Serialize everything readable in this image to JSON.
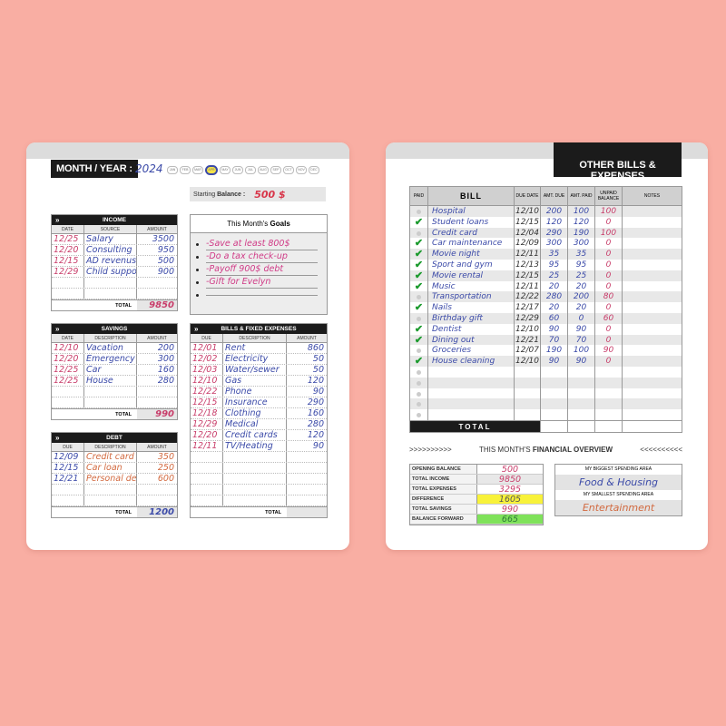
{
  "left": {
    "month_year_label": "MONTH / YEAR :",
    "year": "2024",
    "months": [
      "JAN",
      "FEB",
      "MAR",
      "APR",
      "MAY",
      "JUN",
      "JUL",
      "AUG",
      "SEP",
      "OCT",
      "NOV",
      "DEC"
    ],
    "selected_month": "APR",
    "starting_balance_label": "Starting",
    "starting_balance_label_bold": "Balance :",
    "starting_balance": "500 $",
    "income": {
      "title": "INCOME",
      "columns": [
        "DATE",
        "SOURCE",
        "AMOUNT"
      ],
      "rows": [
        {
          "date": "12/25",
          "desc": "Salary",
          "amount": "3500"
        },
        {
          "date": "12/20",
          "desc": "Consulting",
          "amount": "950"
        },
        {
          "date": "12/15",
          "desc": "AD revenus",
          "amount": "500"
        },
        {
          "date": "12/29",
          "desc": "Child support",
          "amount": "900"
        },
        {
          "date": "",
          "desc": "",
          "amount": ""
        },
        {
          "date": "",
          "desc": "",
          "amount": ""
        }
      ],
      "total_label": "TOTAL",
      "total": "9850"
    },
    "goals": {
      "title": "This Month's",
      "title_bold": "Goals",
      "items": [
        "-Save at least 800$",
        "-Do a tax check-up",
        "-Payoff 900$ debt",
        "-Gift for Evelyn",
        ""
      ]
    },
    "savings": {
      "title": "SAVINGS",
      "columns": [
        "DATE",
        "DESCRIPTION",
        "AMOUNT"
      ],
      "rows": [
        {
          "date": "12/10",
          "desc": "Vacation",
          "amount": "200"
        },
        {
          "date": "12/20",
          "desc": "Emergency",
          "amount": "300"
        },
        {
          "date": "12/25",
          "desc": "Car",
          "amount": "160"
        },
        {
          "date": "12/25",
          "desc": "House",
          "amount": "280"
        },
        {
          "date": "",
          "desc": "",
          "amount": ""
        },
        {
          "date": "",
          "desc": "",
          "amount": ""
        }
      ],
      "total_label": "TOTAL",
      "total": "990"
    },
    "bills": {
      "title": "BILLS & FIXED EXPENSES",
      "columns": [
        "DUE",
        "DESCRIPTION",
        "AMOUNT"
      ],
      "rows": [
        {
          "date": "12/01",
          "desc": "Rent",
          "amount": "860"
        },
        {
          "date": "12/02",
          "desc": "Electricity",
          "amount": "50"
        },
        {
          "date": "12/03",
          "desc": "Water/sewer",
          "amount": "50"
        },
        {
          "date": "12/10",
          "desc": "Gas",
          "amount": "120"
        },
        {
          "date": "12/22",
          "desc": "Phone",
          "amount": "90"
        },
        {
          "date": "12/15",
          "desc": "Insurance",
          "amount": "290"
        },
        {
          "date": "12/18",
          "desc": "Clothing",
          "amount": "160"
        },
        {
          "date": "12/29",
          "desc": "Medical",
          "amount": "280"
        },
        {
          "date": "12/20",
          "desc": "Credit cards",
          "amount": "120"
        },
        {
          "date": "12/11",
          "desc": "TV/Heating",
          "amount": "90"
        },
        {
          "date": "",
          "desc": "",
          "amount": ""
        },
        {
          "date": "",
          "desc": "",
          "amount": ""
        },
        {
          "date": "",
          "desc": "",
          "amount": ""
        },
        {
          "date": "",
          "desc": "",
          "amount": ""
        },
        {
          "date": "",
          "desc": "",
          "amount": ""
        }
      ],
      "total_label": "TOTAL",
      "total": ""
    },
    "debt": {
      "title": "DEBT",
      "columns": [
        "DUE",
        "DESCRIPTION",
        "AMOUNT"
      ],
      "rows": [
        {
          "date": "12/09",
          "desc": "Credit card",
          "amount": "350"
        },
        {
          "date": "12/15",
          "desc": "Car loan",
          "amount": "250"
        },
        {
          "date": "12/21",
          "desc": "Personal debt",
          "amount": "600"
        },
        {
          "date": "",
          "desc": "",
          "amount": ""
        },
        {
          "date": "",
          "desc": "",
          "amount": ""
        }
      ],
      "total_label": "TOTAL",
      "total": "1200"
    }
  },
  "right": {
    "title": "OTHER",
    "title_bold": "BILLS & EXPENSES",
    "columns": {
      "paid": "PAID",
      "bill": "BILL",
      "due": "DUE DATE",
      "amt_due": "AMT. DUE",
      "amt_paid": "AMT. PAID",
      "unpaid": "UNPAID BALANCE",
      "notes": "NOTES"
    },
    "rows": [
      {
        "paid": false,
        "bill": "Hospital",
        "due": "12/10",
        "amt_due": "200",
        "amt_paid": "100",
        "unpaid": "100"
      },
      {
        "paid": true,
        "bill": "Student loans",
        "due": "12/15",
        "amt_due": "120",
        "amt_paid": "120",
        "unpaid": "0"
      },
      {
        "paid": false,
        "bill": "Credit card",
        "due": "12/04",
        "amt_due": "290",
        "amt_paid": "190",
        "unpaid": "100"
      },
      {
        "paid": true,
        "bill": "Car maintenance",
        "due": "12/09",
        "amt_due": "300",
        "amt_paid": "300",
        "unpaid": "0"
      },
      {
        "paid": true,
        "bill": "Movie night",
        "due": "12/11",
        "amt_due": "35",
        "amt_paid": "35",
        "unpaid": "0"
      },
      {
        "paid": true,
        "bill": "Sport and gym",
        "due": "12/13",
        "amt_due": "95",
        "amt_paid": "95",
        "unpaid": "0"
      },
      {
        "paid": true,
        "bill": "Movie rental",
        "due": "12/15",
        "amt_due": "25",
        "amt_paid": "25",
        "unpaid": "0"
      },
      {
        "paid": true,
        "bill": "Music",
        "due": "12/11",
        "amt_due": "20",
        "amt_paid": "20",
        "unpaid": "0"
      },
      {
        "paid": false,
        "bill": "Transportation",
        "due": "12/22",
        "amt_due": "280",
        "amt_paid": "200",
        "unpaid": "80"
      },
      {
        "paid": true,
        "bill": "Nails",
        "due": "12/17",
        "amt_due": "20",
        "amt_paid": "20",
        "unpaid": "0"
      },
      {
        "paid": false,
        "bill": "Birthday gift",
        "due": "12/29",
        "amt_due": "60",
        "amt_paid": "0",
        "unpaid": "60"
      },
      {
        "paid": true,
        "bill": "Dentist",
        "due": "12/10",
        "amt_due": "90",
        "amt_paid": "90",
        "unpaid": "0"
      },
      {
        "paid": true,
        "bill": "Dining out",
        "due": "12/21",
        "amt_due": "70",
        "amt_paid": "70",
        "unpaid": "0"
      },
      {
        "paid": false,
        "bill": "Groceries",
        "due": "12/07",
        "amt_due": "190",
        "amt_paid": "100",
        "unpaid": "90"
      },
      {
        "paid": true,
        "bill": "House cleaning",
        "due": "12/10",
        "amt_due": "90",
        "amt_paid": "90",
        "unpaid": "0"
      },
      {
        "paid": false,
        "bill": "",
        "due": "",
        "amt_due": "",
        "amt_paid": "",
        "unpaid": ""
      },
      {
        "paid": false,
        "bill": "",
        "due": "",
        "amt_due": "",
        "amt_paid": "",
        "unpaid": ""
      },
      {
        "paid": false,
        "bill": "",
        "due": "",
        "amt_due": "",
        "amt_paid": "",
        "unpaid": ""
      },
      {
        "paid": false,
        "bill": "",
        "due": "",
        "amt_due": "",
        "amt_paid": "",
        "unpaid": ""
      },
      {
        "paid": false,
        "bill": "",
        "due": "",
        "amt_due": "",
        "amt_paid": "",
        "unpaid": ""
      }
    ],
    "total_label": "TOTAL",
    "overview": {
      "arrows_left": ">>>>>>>>>>",
      "title": "THIS MONTH'S",
      "title_bold": "FINANCIAL OVERVIEW",
      "arrows_right": "<<<<<<<<<<",
      "items": [
        {
          "label": "OPENING BALANCE",
          "value": "500",
          "highlight": ""
        },
        {
          "label": "TOTAL INCOME",
          "value": "9850",
          "highlight": ""
        },
        {
          "label": "TOTAL EXPENSES",
          "value": "3295",
          "highlight": ""
        },
        {
          "label": "DIFFERENCE",
          "value": "1605",
          "highlight": "#f8f23a"
        },
        {
          "label": "TOTAL SAVINGS",
          "value": "990",
          "highlight": ""
        },
        {
          "label": "BALANCE FORWARD",
          "value": "665",
          "highlight": "#7fe25a"
        }
      ],
      "biggest_label_bold": "MY BIGGEST",
      "biggest_label": "SPENDING AREA",
      "biggest_value": "Food & Housing",
      "smallest_label_bold": "MY SMALLEST",
      "smallest_label": "SPENDING AREA",
      "smallest_value": "Entertainment"
    }
  },
  "colors": {
    "background": "#f9aea3",
    "ink_pink": "#c83d6a",
    "ink_blue": "#3b4aa8",
    "ink_red": "#d26a40",
    "check_green": "#1b9a2d"
  }
}
